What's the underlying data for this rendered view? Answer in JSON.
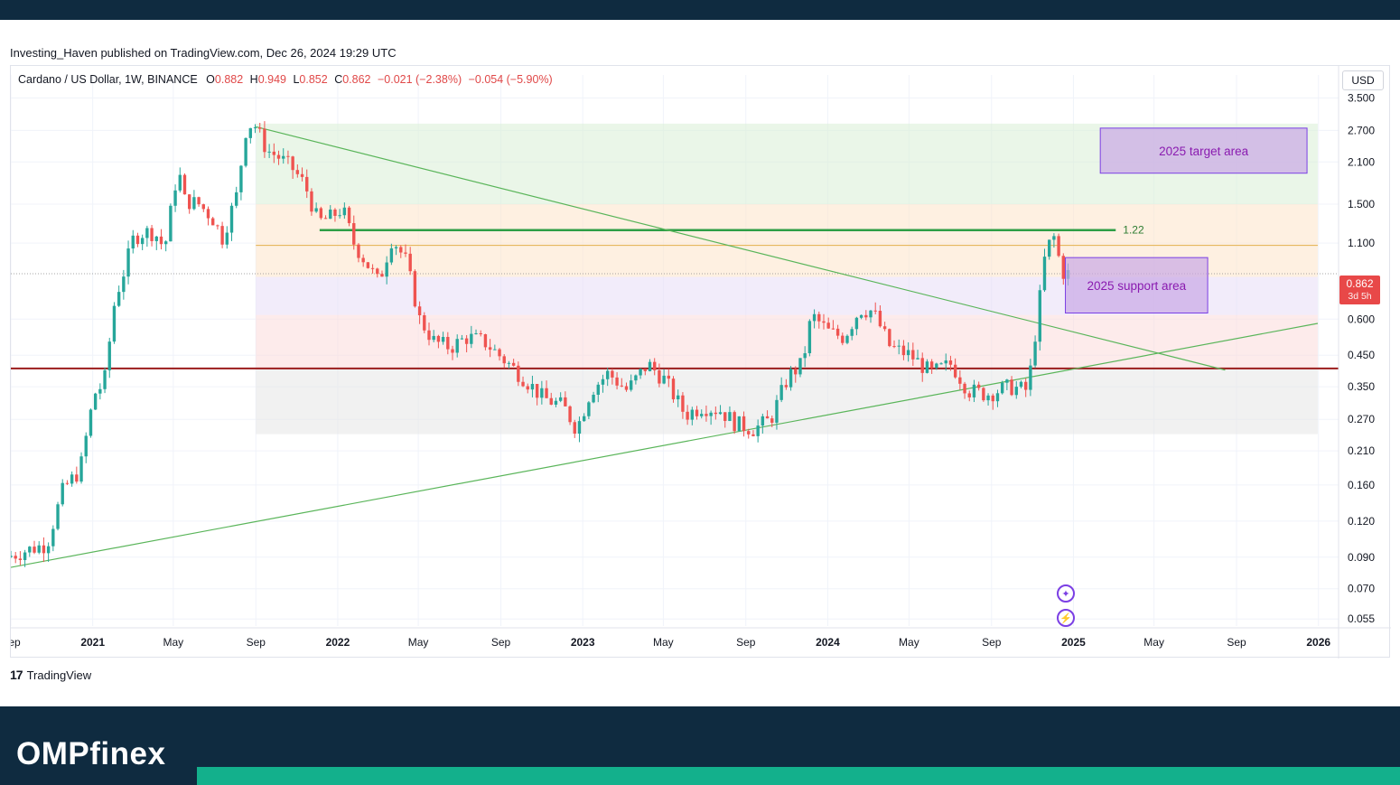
{
  "header": {
    "publish_text": "Investing_Haven published on TradingView.com, Dec 26, 2024 19:29 UTC"
  },
  "symbol": {
    "name": "Cardano / US Dollar, 1W, BINANCE",
    "o_label": "O",
    "o_value": "0.882",
    "h_label": "H",
    "h_value": "0.949",
    "l_label": "L",
    "l_value": "0.852",
    "c_label": "C",
    "c_value": "0.862",
    "change": "−0.021 (−2.38%)",
    "change2": "−0.054 (−5.90%)"
  },
  "currency": "USD",
  "last_price": {
    "value": "0.862",
    "countdown": "3d 5h"
  },
  "footer": {
    "tv_mark": "17",
    "tv_label": "TradingView",
    "brand": "OMPfinex"
  },
  "colors": {
    "up": "#26a69a",
    "down": "#ef5350",
    "accent_purple": "#7b3fe4",
    "band_bg": "#0f2b40",
    "brand_green": "#13b08c"
  },
  "icons": [
    "tradingview-logo-icon",
    "sparkle-icon",
    "lightning-icon"
  ],
  "chart_data": {
    "type": "candlestick",
    "scale": "log",
    "ylim": [
      0.052,
      4.2
    ],
    "xlim": [
      "2020-09-01",
      "2026-01-31"
    ],
    "grid": true,
    "y_ticks": [
      "3.500",
      "2.700",
      "2.100",
      "1.500",
      "1.100",
      "0.600",
      "0.450",
      "0.350",
      "0.270",
      "0.210",
      "0.160",
      "0.120",
      "0.090",
      "0.070",
      "0.055"
    ],
    "x_ticks": [
      {
        "label": "Sep",
        "date": "2020-09-01",
        "bold": false
      },
      {
        "label": "2021",
        "date": "2021-01-01",
        "bold": true
      },
      {
        "label": "May",
        "date": "2021-05-01",
        "bold": false
      },
      {
        "label": "Sep",
        "date": "2021-09-01",
        "bold": false
      },
      {
        "label": "2022",
        "date": "2022-01-01",
        "bold": true
      },
      {
        "label": "May",
        "date": "2022-05-01",
        "bold": false
      },
      {
        "label": "Sep",
        "date": "2022-09-01",
        "bold": false
      },
      {
        "label": "2023",
        "date": "2023-01-01",
        "bold": true
      },
      {
        "label": "May",
        "date": "2023-05-01",
        "bold": false
      },
      {
        "label": "Sep",
        "date": "2023-09-01",
        "bold": false
      },
      {
        "label": "2024",
        "date": "2024-01-01",
        "bold": true
      },
      {
        "label": "May",
        "date": "2024-05-01",
        "bold": false
      },
      {
        "label": "Sep",
        "date": "2024-09-01",
        "bold": false
      },
      {
        "label": "2025",
        "date": "2025-01-01",
        "bold": true
      },
      {
        "label": "May",
        "date": "2025-05-01",
        "bold": false
      },
      {
        "label": "Sep",
        "date": "2025-09-01",
        "bold": false
      },
      {
        "label": "2026",
        "date": "2026-01-01",
        "bold": true
      }
    ],
    "price_path": [
      [
        "2020-09-01",
        0.09
      ],
      [
        "2020-10-01",
        0.095
      ],
      [
        "2020-11-01",
        0.1
      ],
      [
        "2020-11-25",
        0.155
      ],
      [
        "2020-12-20",
        0.18
      ],
      [
        "2021-01-10",
        0.33
      ],
      [
        "2021-01-25",
        0.36
      ],
      [
        "2021-02-10",
        0.7
      ],
      [
        "2021-02-25",
        0.9
      ],
      [
        "2021-03-10",
        1.15
      ],
      [
        "2021-03-25",
        1.2
      ],
      [
        "2021-04-10",
        1.2
      ],
      [
        "2021-04-25",
        1.05
      ],
      [
        "2021-05-15",
        2.0
      ],
      [
        "2021-05-25",
        1.55
      ],
      [
        "2021-06-15",
        1.5
      ],
      [
        "2021-07-05",
        1.35
      ],
      [
        "2021-07-20",
        1.15
      ],
      [
        "2021-08-10",
        1.6
      ],
      [
        "2021-08-25",
        2.8
      ],
      [
        "2021-09-05",
        2.85
      ],
      [
        "2021-09-25",
        2.3
      ],
      [
        "2021-10-10",
        2.2
      ],
      [
        "2021-11-01",
        2.0
      ],
      [
        "2021-11-20",
        1.75
      ],
      [
        "2021-12-10",
        1.3
      ],
      [
        "2021-12-28",
        1.35
      ],
      [
        "2022-01-15",
        1.45
      ],
      [
        "2022-02-01",
        1.1
      ],
      [
        "2022-02-25",
        0.9
      ],
      [
        "2022-03-10",
        0.8
      ],
      [
        "2022-03-30",
        1.15
      ],
      [
        "2022-04-20",
        0.95
      ],
      [
        "2022-05-10",
        0.6
      ],
      [
        "2022-06-01",
        0.5
      ],
      [
        "2022-06-25",
        0.48
      ],
      [
        "2022-07-20",
        0.52
      ],
      [
        "2022-08-15",
        0.5
      ],
      [
        "2022-09-10",
        0.44
      ],
      [
        "2022-10-10",
        0.38
      ],
      [
        "2022-11-10",
        0.32
      ],
      [
        "2022-12-10",
        0.3
      ],
      [
        "2022-12-30",
        0.25
      ],
      [
        "2023-01-20",
        0.34
      ],
      [
        "2023-02-15",
        0.39
      ],
      [
        "2023-03-15",
        0.34
      ],
      [
        "2023-04-15",
        0.42
      ],
      [
        "2023-05-10",
        0.37
      ],
      [
        "2023-06-10",
        0.28
      ],
      [
        "2023-07-05",
        0.3
      ],
      [
        "2023-08-01",
        0.29
      ],
      [
        "2023-08-25",
        0.26
      ],
      [
        "2023-09-20",
        0.25
      ],
      [
        "2023-10-15",
        0.27
      ],
      [
        "2023-11-10",
        0.38
      ],
      [
        "2023-12-01",
        0.42
      ],
      [
        "2023-12-15",
        0.62
      ],
      [
        "2024-01-10",
        0.54
      ],
      [
        "2024-02-01",
        0.52
      ],
      [
        "2024-02-25",
        0.65
      ],
      [
        "2024-03-15",
        0.64
      ],
      [
        "2024-04-10",
        0.48
      ],
      [
        "2024-05-10",
        0.45
      ],
      [
        "2024-06-10",
        0.39
      ],
      [
        "2024-07-10",
        0.42
      ],
      [
        "2024-08-05",
        0.34
      ],
      [
        "2024-09-01",
        0.33
      ],
      [
        "2024-10-05",
        0.35
      ],
      [
        "2024-11-01",
        0.34
      ],
      [
        "2024-11-15",
        0.6
      ],
      [
        "2024-11-28",
        1.05
      ],
      [
        "2024-12-10",
        1.15
      ],
      [
        "2024-12-22",
        0.88
      ],
      [
        "2024-12-26",
        0.862
      ]
    ],
    "drawings": {
      "horizontal_levels": [
        {
          "value": 1.22,
          "label": "1.22",
          "color": "#2e9e45",
          "width": 2.5,
          "from": "2021-12-05",
          "to": "2025-03-05"
        },
        {
          "value": 1.08,
          "label": "",
          "color": "#e3b04b",
          "width": 1,
          "from": "2021-09-01",
          "to": "2025-12-31"
        },
        {
          "value": 0.405,
          "label": "",
          "color": "#9b1c1c",
          "width": 2,
          "from": "2020-09-01",
          "to": "2026-01-31"
        }
      ],
      "zones": [
        {
          "from": "2021-09-01",
          "to": "2025-12-31",
          "low": 1.5,
          "high": 2.85,
          "color": "#d8efd6"
        },
        {
          "from": "2021-09-01",
          "to": "2025-12-31",
          "low": 0.84,
          "high": 1.5,
          "color": "#fde3c8"
        },
        {
          "from": "2021-09-01",
          "to": "2025-12-31",
          "low": 0.62,
          "high": 0.84,
          "color": "#e8dcf5"
        },
        {
          "from": "2021-09-01",
          "to": "2025-12-31",
          "low": 0.405,
          "high": 0.62,
          "color": "#fbdada"
        },
        {
          "from": "2021-09-01",
          "to": "2025-12-31",
          "low": 0.24,
          "high": 0.405,
          "color": "#e6e6e6"
        }
      ],
      "trendlines": [
        {
          "from": [
            "2020-09-01",
            0.083
          ],
          "to": [
            "2025-12-31",
            0.58
          ],
          "color": "#5ab55a"
        },
        {
          "from": [
            "2021-09-01",
            2.78
          ],
          "to": [
            "2025-08-15",
            0.4
          ],
          "color": "#5ab55a"
        }
      ],
      "boxes": [
        {
          "label": "2025 target area",
          "from": "2025-02-10",
          "to": "2025-12-15",
          "low": 1.92,
          "high": 2.75
        },
        {
          "label": "2025 support area",
          "from": "2024-12-20",
          "to": "2025-07-20",
          "low": 0.63,
          "high": 0.98
        }
      ]
    }
  }
}
